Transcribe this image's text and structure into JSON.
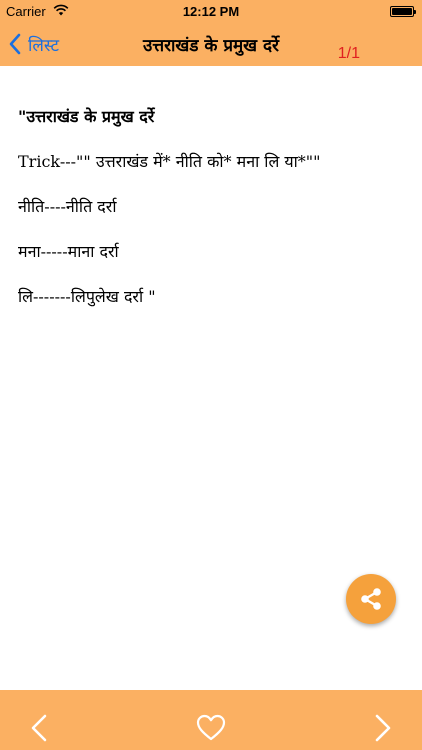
{
  "status_bar": {
    "carrier": "Carrier",
    "time": "12:12 PM",
    "wifi_icon": "wifi-icon",
    "battery_icon": "battery-full-icon"
  },
  "nav": {
    "back_label": "लिस्ट",
    "back_icon": "chevron-left-icon",
    "title": "उत्तराखंड के प्रमुख दर्रे",
    "page_counter": "1/1"
  },
  "content": {
    "heading": "\"उत्तराखंड के प्रमुख दर्रे",
    "lines": [
      "Trick---\"\" उत्तराखंड में* नीति को* मना लि या*\"\"",
      "नीति----नीति दर्रा",
      "मना-----माना दर्रा",
      "लि-------लिपुलेख दर्रा \""
    ]
  },
  "share_button": {
    "icon": "share-icon"
  },
  "bottom_bar": {
    "prev_icon": "chevron-left-icon",
    "favorite_icon": "heart-outline-icon",
    "next_icon": "chevron-right-icon"
  },
  "colors": {
    "header_bg": "#fbb062",
    "accent_blue": "#1a6fe0",
    "counter_red": "#e02020",
    "share_button": "#f5a13c"
  }
}
